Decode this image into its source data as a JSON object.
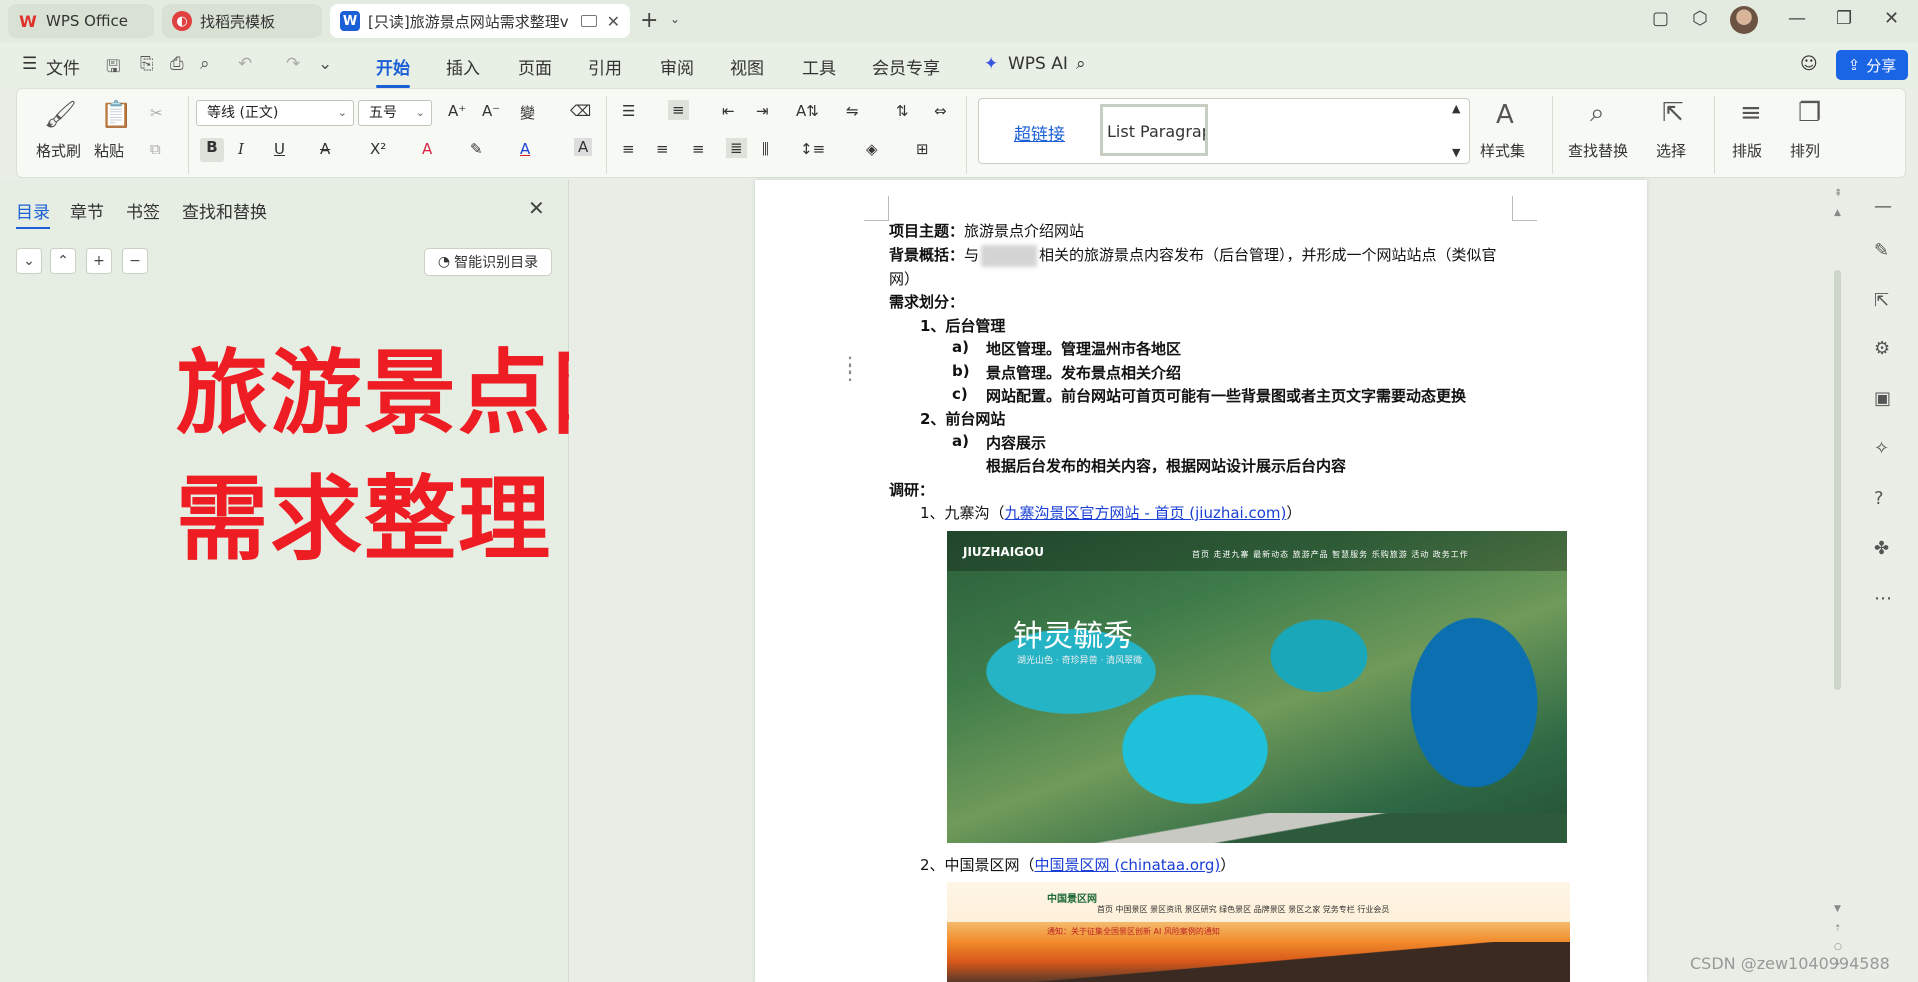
{
  "tabs": [
    {
      "label": "WPS Office"
    },
    {
      "label": "找稻壳模板"
    },
    {
      "label": "[只读]旅游景点网站需求整理v"
    }
  ],
  "menu": {
    "file": "文件",
    "items": [
      "开始",
      "插入",
      "页面",
      "引用",
      "审阅",
      "视图",
      "工具",
      "会员专享"
    ],
    "wps_ai": "WPS AI",
    "share": "分享"
  },
  "ribbon": {
    "format_painter": "格式刷",
    "paste": "粘贴",
    "font_name": "等线 (正文)",
    "font_size": "五号",
    "hyperlink_style": "超链接",
    "list_paragraph_style": "List Paragraph",
    "style_set": "样式集",
    "find_replace": "查找替换",
    "select": "选择",
    "layout": "排版",
    "arrange": "排列"
  },
  "nav": {
    "tabs": [
      "目录",
      "章节",
      "书签",
      "查找和替换"
    ],
    "smart_toc": "智能识别目录",
    "big_title_line1": "旅游景点网站",
    "big_title_line2": "需求整理"
  },
  "doc": {
    "project_label": "项目主题：",
    "project_value": "旅游景点介绍网站",
    "bg_label": "背景概括：",
    "bg_pre": "与",
    "bg_post": "相关的旅游景点内容发布（后台管理），并形成一个网站站点（类似官",
    "bg_line2": "网）",
    "req_label": "需求划分：",
    "s1": "1、后台管理",
    "s1a_mark": "a)",
    "s1a": "地区管理。管理温州市各地区",
    "s1b_mark": "b)",
    "s1b": "景点管理。发布景点相关介绍",
    "s1c_mark": "c)",
    "s1c": "网站配置。前台网站可首页可能有一些背景图或者主页文字需要动态更换",
    "s2": "2、前台网站",
    "s2a_mark": "a)",
    "s2a": "内容展示",
    "s2a_desc": "根据后台发布的相关内容，根据网站设计展示后台内容",
    "research_label": "调研：",
    "r1_pre": "1、九寨沟（",
    "r1_link": "九寨沟景区官方网站 - 首页 (jiuzhai.com)",
    "r1_post": "）",
    "r2_pre": "2、中国景区网（",
    "r2_link": "中国景区网 (chinataa.org)",
    "r2_post": "）",
    "img1": {
      "logo": "JIUZHAIGOU",
      "menu": "首页  走进九寨  最新动态  旅游产品  智慧服务  乐购旅游  活动  政务工作",
      "hero": "钟灵毓秀",
      "sub": "湖光山色 · 奇珍异兽 · 清风翠微"
    },
    "img2": {
      "logo": "中国景区网",
      "menu": "首页  中国景区  景区资讯  景区研究  绿色景区  品牌景区  景区之家  党务专栏  行业会员",
      "notice": "通知：关于征集全国景区创新 AI 风险案例的通知"
    }
  },
  "watermark": "CSDN @zew1040994588"
}
